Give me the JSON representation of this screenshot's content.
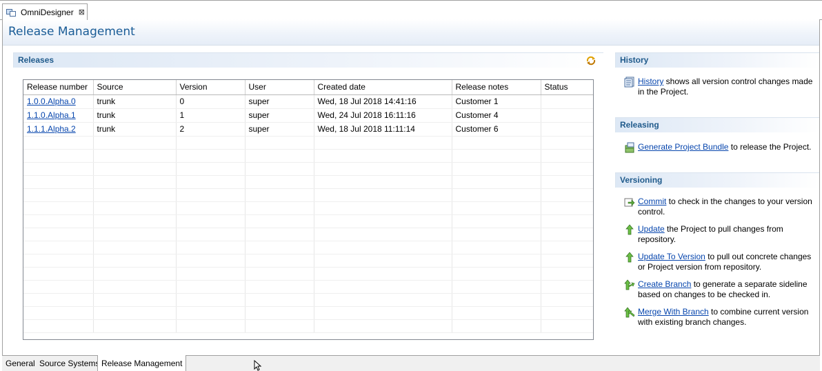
{
  "editor_tab": {
    "title": "OmniDesigner",
    "close_glyph": "⊠",
    "icon": "omnidesigner-icon"
  },
  "form": {
    "title": "Release Management"
  },
  "releases": {
    "title": "Releases",
    "sync_icon": "sync-icon",
    "columns": [
      "Release number",
      "Source",
      "Version",
      "User",
      "Created date",
      "Release notes",
      "Status"
    ],
    "rows": [
      [
        "1.0.0.Alpha.0",
        "trunk",
        "0",
        "super",
        "Wed, 18 Jul 2018 14:41:16",
        "Customer 1",
        ""
      ],
      [
        "1.1.0.Alpha.1",
        "trunk",
        "1",
        "super",
        "Wed, 24 Jul 2018 16:11:16",
        "Customer 4",
        ""
      ],
      [
        "1.1.1.Alpha.2",
        "trunk",
        "2",
        "super",
        "Wed, 18 Jul 2018 11:11:14",
        "Customer 6",
        ""
      ]
    ]
  },
  "history": {
    "title": "History",
    "link": "History",
    "text": " shows all version control changes made in the Project."
  },
  "releasing": {
    "title": "Releasing",
    "link": "Generate Project Bundle",
    "text": " to release the Project."
  },
  "versioning": {
    "title": "Versioning",
    "items": [
      {
        "link": "Commit",
        "text": " to check in the changes to your version control.",
        "icon": "commit-icon"
      },
      {
        "link": "Update",
        "text": " the Project to pull changes from repository.",
        "icon": "update-arrow-icon"
      },
      {
        "link": "Update To Version",
        "text": " to pull out concrete changes or Project version from repository.",
        "icon": "update-arrow-icon"
      },
      {
        "link": "Create Branch",
        "text": " to generate a separate sideline based on changes to be checked in.",
        "icon": "branch-icon"
      },
      {
        "link": "Merge With Branch",
        "text": " to combine current version with existing branch changes.",
        "icon": "merge-icon"
      }
    ]
  },
  "page_tabs": [
    "General",
    "Source Systems",
    "Release Management"
  ],
  "active_page_tab": "Release Management",
  "colors": {
    "title_blue": "#1a5c96",
    "link_blue": "#0645ad",
    "section_blue": "#1f5a8b"
  }
}
